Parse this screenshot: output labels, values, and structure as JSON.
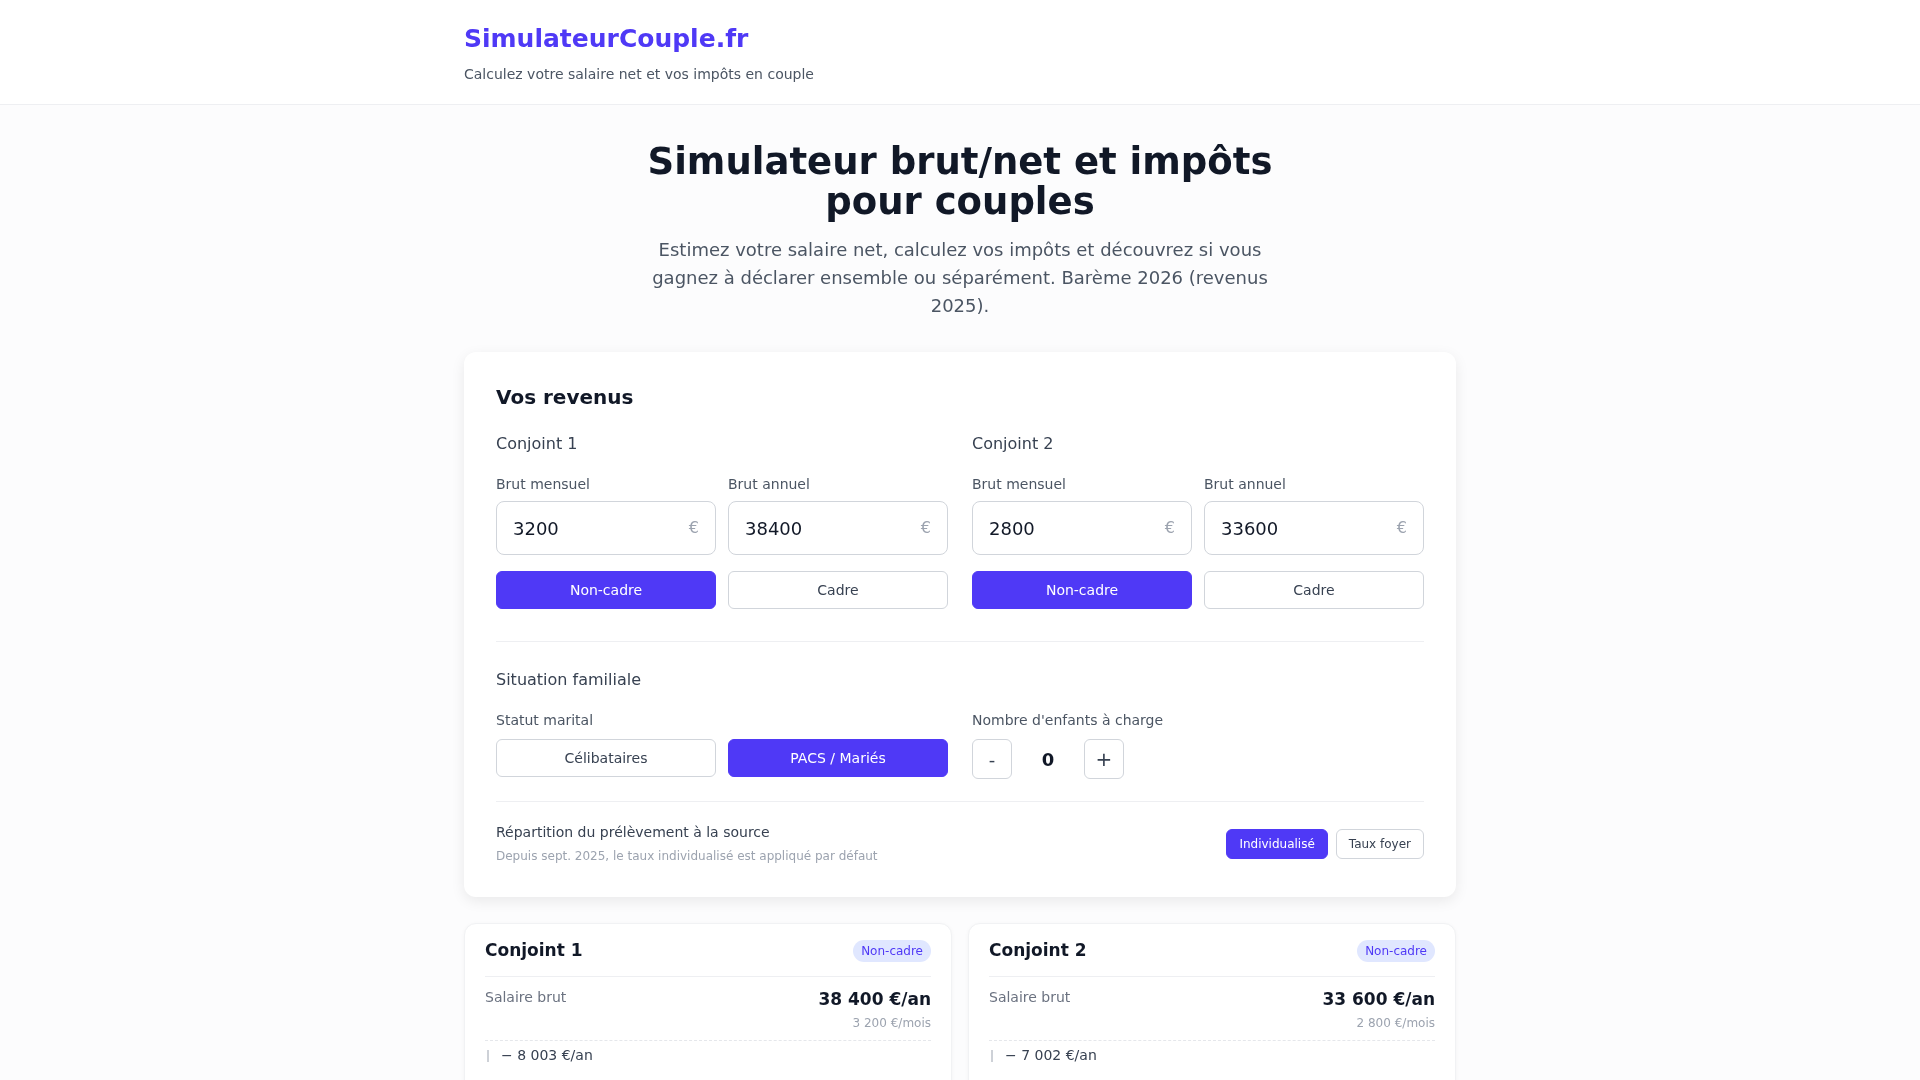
{
  "header": {
    "logo": "SimulateurCouple.fr",
    "tagline": "Calculez votre salaire net et vos impôts en couple"
  },
  "hero": {
    "title": "Simulateur brut/net et impôts pour couples",
    "subtitle": "Estimez votre salaire net, calculez vos impôts et découvrez si vous gagnez à déclarer ensemble ou séparément. Barème 2026 (revenus 2025)."
  },
  "revenus": {
    "title": "Vos revenus",
    "spouses": [
      {
        "name": "Conjoint 1",
        "fields": [
          {
            "label": "Brut mensuel",
            "value": "3200",
            "unit": "€"
          },
          {
            "label": "Brut annuel",
            "value": "38400",
            "unit": "€"
          }
        ],
        "status": [
          {
            "label": "Non-cadre",
            "selected": true
          },
          {
            "label": "Cadre",
            "selected": false
          }
        ]
      },
      {
        "name": "Conjoint 2",
        "fields": [
          {
            "label": "Brut mensuel",
            "value": "2800",
            "unit": "€"
          },
          {
            "label": "Brut annuel",
            "value": "33600",
            "unit": "€"
          }
        ],
        "status": [
          {
            "label": "Non-cadre",
            "selected": true
          },
          {
            "label": "Cadre",
            "selected": false
          }
        ]
      }
    ],
    "situation": {
      "title": "Situation familiale",
      "marital_label": "Statut marital",
      "marital": [
        {
          "label": "Célibataires",
          "selected": false
        },
        {
          "label": "PACS / Mariés",
          "selected": true
        }
      ],
      "children_label": "Nombre d'enfants à charge",
      "minus": "-",
      "children": "0",
      "plus": "+"
    },
    "prelevement": {
      "title": "Répartition du prélèvement à la source",
      "note": "Depuis sept. 2025, le taux individualisé est appliqué par défaut",
      "options": [
        {
          "label": "Individualisé",
          "selected": true
        },
        {
          "label": "Taux foyer",
          "selected": false
        }
      ]
    }
  },
  "results": [
    {
      "name": "Conjoint 1",
      "badge": "Non-cadre",
      "brut_label": "Salaire brut",
      "brut_year": "38 400 €/an",
      "brut_month": "3 200 €/mois",
      "deduction": "− 8 003 €/an"
    },
    {
      "name": "Conjoint 2",
      "badge": "Non-cadre",
      "brut_label": "Salaire brut",
      "brut_year": "33 600 €/an",
      "brut_month": "2 800 €/mois",
      "deduction": "− 7 002 €/an"
    }
  ]
}
